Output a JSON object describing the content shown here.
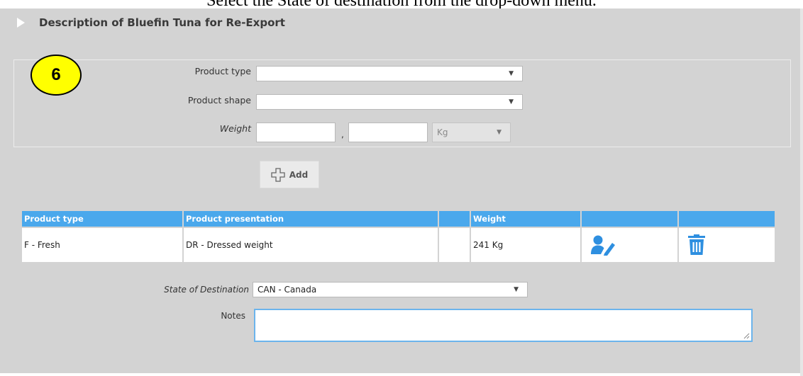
{
  "caption": "Select the State of destination from the drop-down menu.",
  "section": {
    "title": "Description of Bluefin Tuna for Re-Export"
  },
  "step_badge": "6",
  "form": {
    "product_type_label": "Product type",
    "product_type_value": "",
    "product_shape_label": "Product shape",
    "product_shape_value": "",
    "weight_label": "Weight",
    "weight_integer": "",
    "weight_separator": ",",
    "weight_decimal": "",
    "weight_unit": "Kg"
  },
  "add_button": {
    "label": "Add",
    "icon": "plus-icon"
  },
  "table": {
    "headers": [
      "Product type",
      "Product presentation",
      "",
      "Weight",
      "",
      ""
    ],
    "rows": [
      {
        "product_type": "F - Fresh",
        "presentation": "DR - Dressed weight",
        "extra": "",
        "weight": "241 Kg",
        "edit_icon": "edit-user-icon",
        "delete_icon": "trash-icon"
      }
    ]
  },
  "destination": {
    "label": "State of Destination",
    "value": "CAN - Canada"
  },
  "notes": {
    "label": "Notes",
    "value": ""
  },
  "colors": {
    "panel": "#d3d3d3",
    "header_blue": "#4aa8ec",
    "icon_blue": "#2e8fe0",
    "badge_yellow": "#ffff00"
  }
}
